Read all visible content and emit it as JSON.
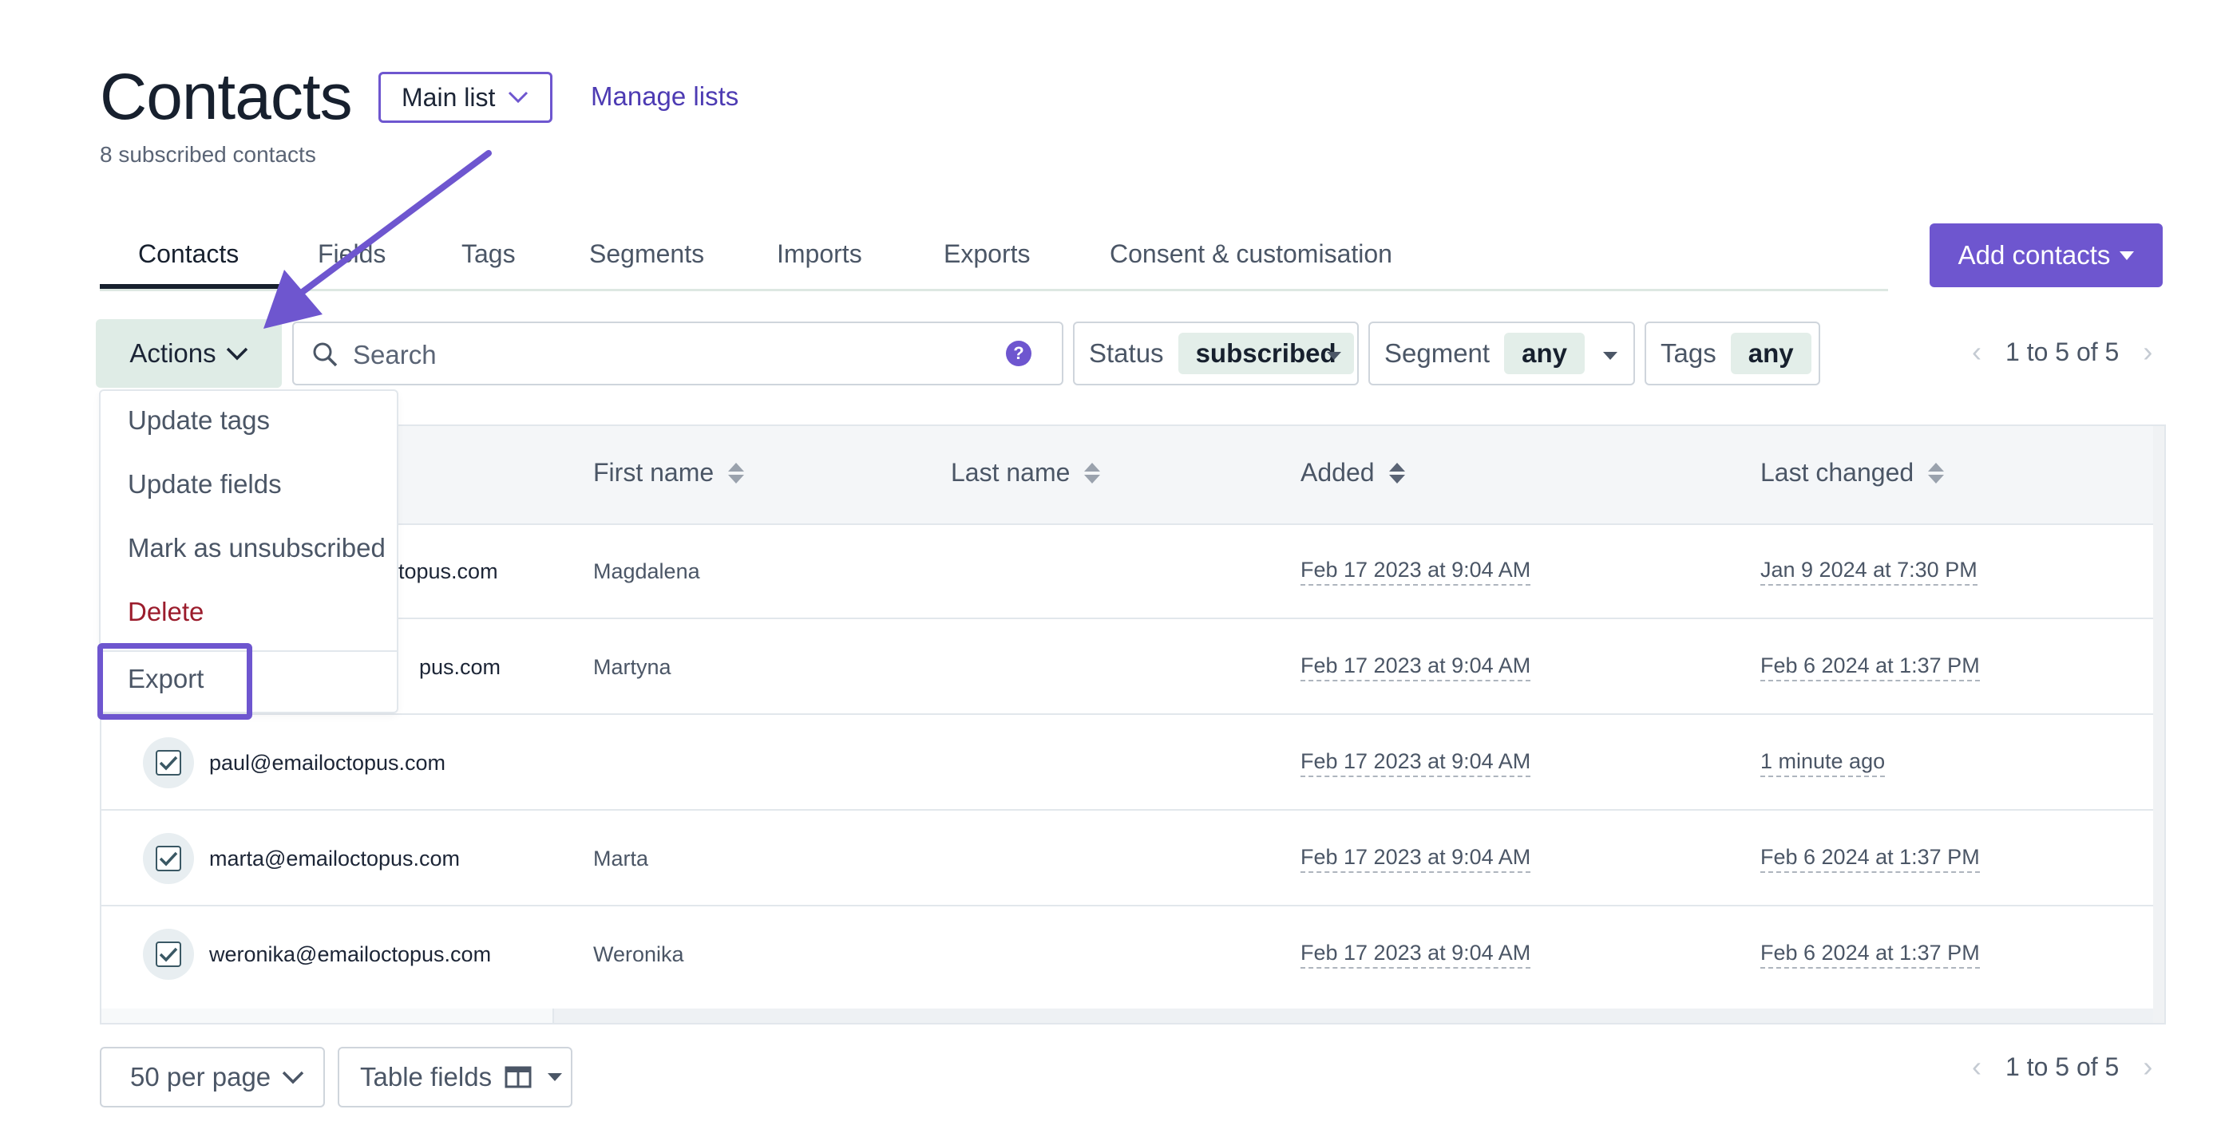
{
  "header": {
    "title": "Contacts",
    "list_selector": "Main list",
    "manage_lists": "Manage lists",
    "subscribed_count": "8 subscribed contacts"
  },
  "tabs": [
    {
      "label": "Contacts",
      "active": true
    },
    {
      "label": "Fields"
    },
    {
      "label": "Tags"
    },
    {
      "label": "Segments"
    },
    {
      "label": "Imports"
    },
    {
      "label": "Exports"
    },
    {
      "label": "Consent & customisation"
    }
  ],
  "add_contacts_label": "Add contacts",
  "toolbar": {
    "actions_label": "Actions",
    "search_placeholder": "Search",
    "filters": {
      "status": {
        "label": "Status",
        "value": "subscribed"
      },
      "segment": {
        "label": "Segment",
        "value": "any"
      },
      "tags": {
        "label": "Tags",
        "value": "any"
      }
    },
    "pagination": "1 to 5 of 5"
  },
  "actions_menu": {
    "items": [
      "Update tags",
      "Update fields",
      "Mark as unsubscribed",
      "Delete",
      "Export"
    ]
  },
  "table": {
    "columns": [
      "First name",
      "Last name",
      "Added",
      "Last changed"
    ],
    "rows": [
      {
        "email": "topus.com",
        "first_name": "Magdalena",
        "last_name": "",
        "added": "Feb 17 2023 at 9:04 AM",
        "last_changed": "Jan 9 2024 at 7:30 PM"
      },
      {
        "email": "pus.com",
        "first_name": "Martyna",
        "last_name": "",
        "added": "Feb 17 2023 at 9:04 AM",
        "last_changed": "Feb 6 2024 at 1:37 PM"
      },
      {
        "email": "paul@emailoctopus.com",
        "first_name": "",
        "last_name": "",
        "added": "Feb 17 2023 at 9:04 AM",
        "last_changed": "1 minute ago"
      },
      {
        "email": "marta@emailoctopus.com",
        "first_name": "Marta",
        "last_name": "",
        "added": "Feb 17 2023 at 9:04 AM",
        "last_changed": "Feb 6 2024 at 1:37 PM"
      },
      {
        "email": "weronika@emailoctopus.com",
        "first_name": "Weronika",
        "last_name": "",
        "added": "Feb 17 2023 at 9:04 AM",
        "last_changed": "Feb 6 2024 at 1:37 PM"
      }
    ]
  },
  "footer": {
    "per_page": "50 per page",
    "table_fields": "Table fields",
    "pagination": "1 to 5 of 5"
  },
  "colors": {
    "accent": "#6e56cf",
    "danger": "#9b1c2c",
    "filter_value_bg": "#e3eee9"
  }
}
